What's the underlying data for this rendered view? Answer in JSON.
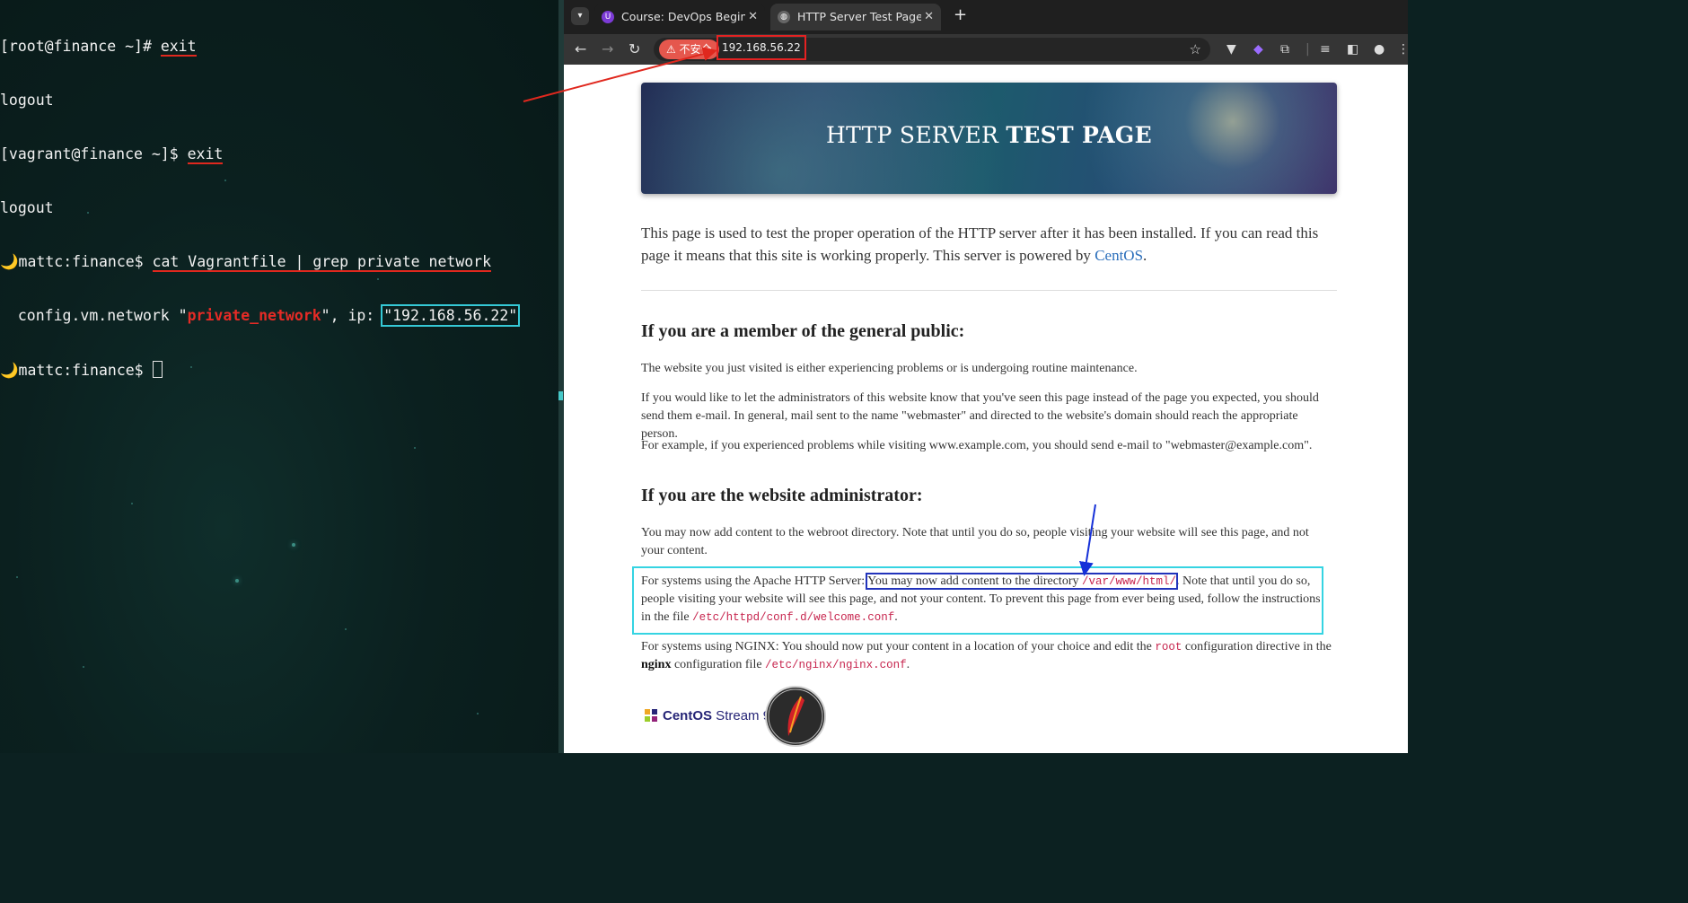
{
  "terminal": {
    "lines": [
      {
        "prompt": "[root@finance ~]# ",
        "cmd": "exit"
      },
      {
        "output": "logout"
      },
      {
        "prompt": "[vagrant@finance ~]$ ",
        "cmd": "exit"
      },
      {
        "output": "logout"
      },
      {
        "prompt_icon": "🌙",
        "prompt": "mattc:finance$ ",
        "cmd": "cat Vagrantfile | grep private network"
      },
      {
        "pre": "  config.vm.network \"",
        "keyword": "private_network",
        "mid": "\", ip: ",
        "ip": "\"192.168.56.22\""
      },
      {
        "prompt_icon": "🌙",
        "prompt": "mattc:finance$ "
      }
    ]
  },
  "browser": {
    "tabs": [
      {
        "title": "Course: DevOps Beginne",
        "favicon": "course-icon",
        "active": false
      },
      {
        "title": "HTTP Server Test Page p",
        "favicon": "globe-icon",
        "active": true
      }
    ],
    "new_tab": "+",
    "security_label": "⚠ 不安全",
    "url": "192.168.56.22"
  },
  "page": {
    "hero_title_normal": "HTTP SERVER ",
    "hero_title_bold": "TEST PAGE",
    "intro_text": "This page is used to test the proper operation of the HTTP server after it has been installed. If you can read this page it means that this site is working properly. This server is powered by ",
    "intro_link": "CentOS",
    "intro_end": ".",
    "section1_title": "If you are a member of the general public:",
    "section1_p1": "The website you just visited is either experiencing problems or is undergoing routine maintenance.",
    "section1_p2": "If you would like to let the administrators of this website know that you've seen this page instead of the page you expected, you should send them e-mail. In general, mail sent to the name \"webmaster\" and directed to the website's domain should reach the appropriate person.",
    "section1_p3": "For example, if you experienced problems while visiting www.example.com, you should send e-mail to \"webmaster@example.com\".",
    "section2_title": "If you are the website administrator:",
    "section2_p1": "You may now add content to the webroot directory. Note that until you do so, people visiting your website will see this page, and not your content.",
    "apache_lead": "For systems using the Apache HTTP Server: ",
    "apache_highlight": "You may now add content to the directory ",
    "apache_dir": "/var/www/html/",
    "apache_rest": ". Note that until you do so, people visiting your website will see this page, and not your content. To prevent this page from ever being used, follow the instructions in the file ",
    "apache_file": "/etc/httpd/conf.d/welcome.conf",
    "apache_end": ".",
    "nginx_lead": "For systems using NGINX: You should now put your content in a location of your choice and edit the ",
    "nginx_root": "root",
    "nginx_mid": " configuration directive in the ",
    "nginx_bold": "nginx",
    "nginx_mid2": " configuration file ",
    "nginx_file": "/etc/nginx/nginx.conf",
    "nginx_end": ".",
    "centos_logo_bold": "CentOS",
    "centos_logo_rest": " Stream 9",
    "apache_badge": "POWERED BY APACHE"
  },
  "colors": {
    "terminal_bg": "#0b201f",
    "annotation_red": "#e0281e",
    "annotation_cyan": "#35d4e2",
    "annotation_blue": "#2233bb",
    "link_blue": "#2a6ebb",
    "code_pink": "#c7254e"
  }
}
